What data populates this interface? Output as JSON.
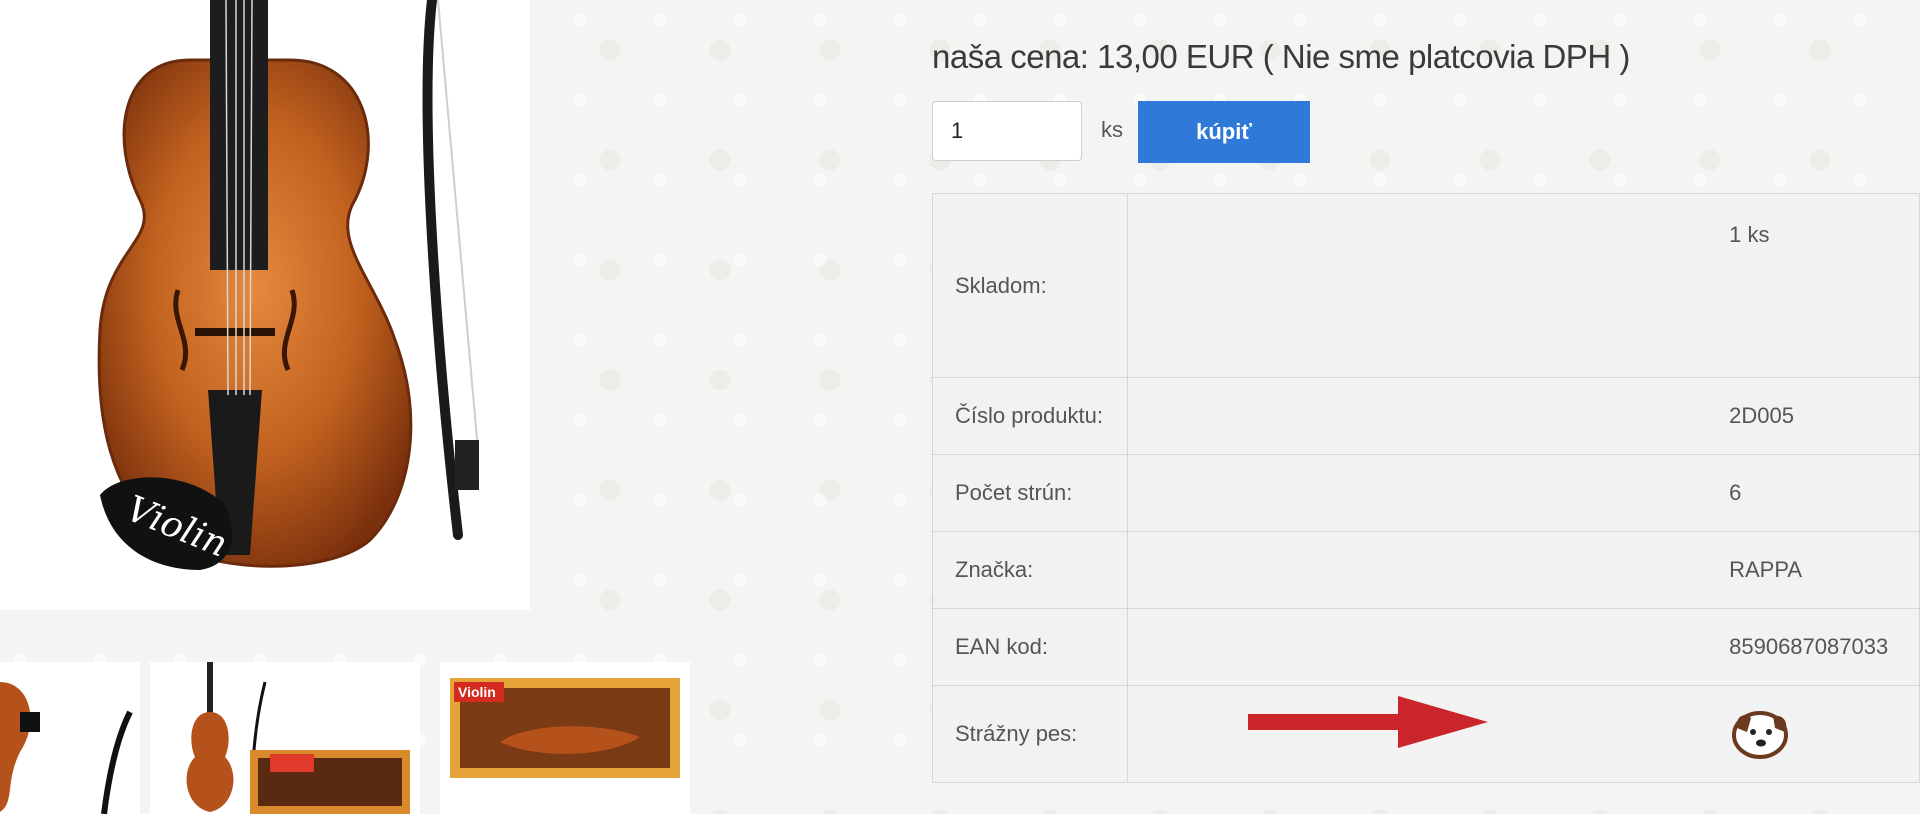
{
  "product": {
    "price_label": "naša cena: 13,00  EUR ( Nie sme platcovia DPH )",
    "quantity_value": "1",
    "quantity_unit": "ks",
    "buy_label": "kúpiť",
    "main_image_text": "Violin",
    "thumbnail_box_text": "Violin"
  },
  "details": [
    {
      "label": "Skladom:",
      "value": "1 ks"
    },
    {
      "label": "Číslo produktu:",
      "value": "2D005"
    },
    {
      "label": "Počet strún:",
      "value": "6"
    },
    {
      "label": "Značka:",
      "value": "RAPPA"
    },
    {
      "label": "EAN kod:",
      "value": "8590687087033"
    },
    {
      "label": "Strážny pes:",
      "value_icon": "watchdog-icon"
    }
  ],
  "colors": {
    "buy_button": "#2f7ad8",
    "arrow": "#c9252b",
    "violin_body": "#b5521c"
  }
}
